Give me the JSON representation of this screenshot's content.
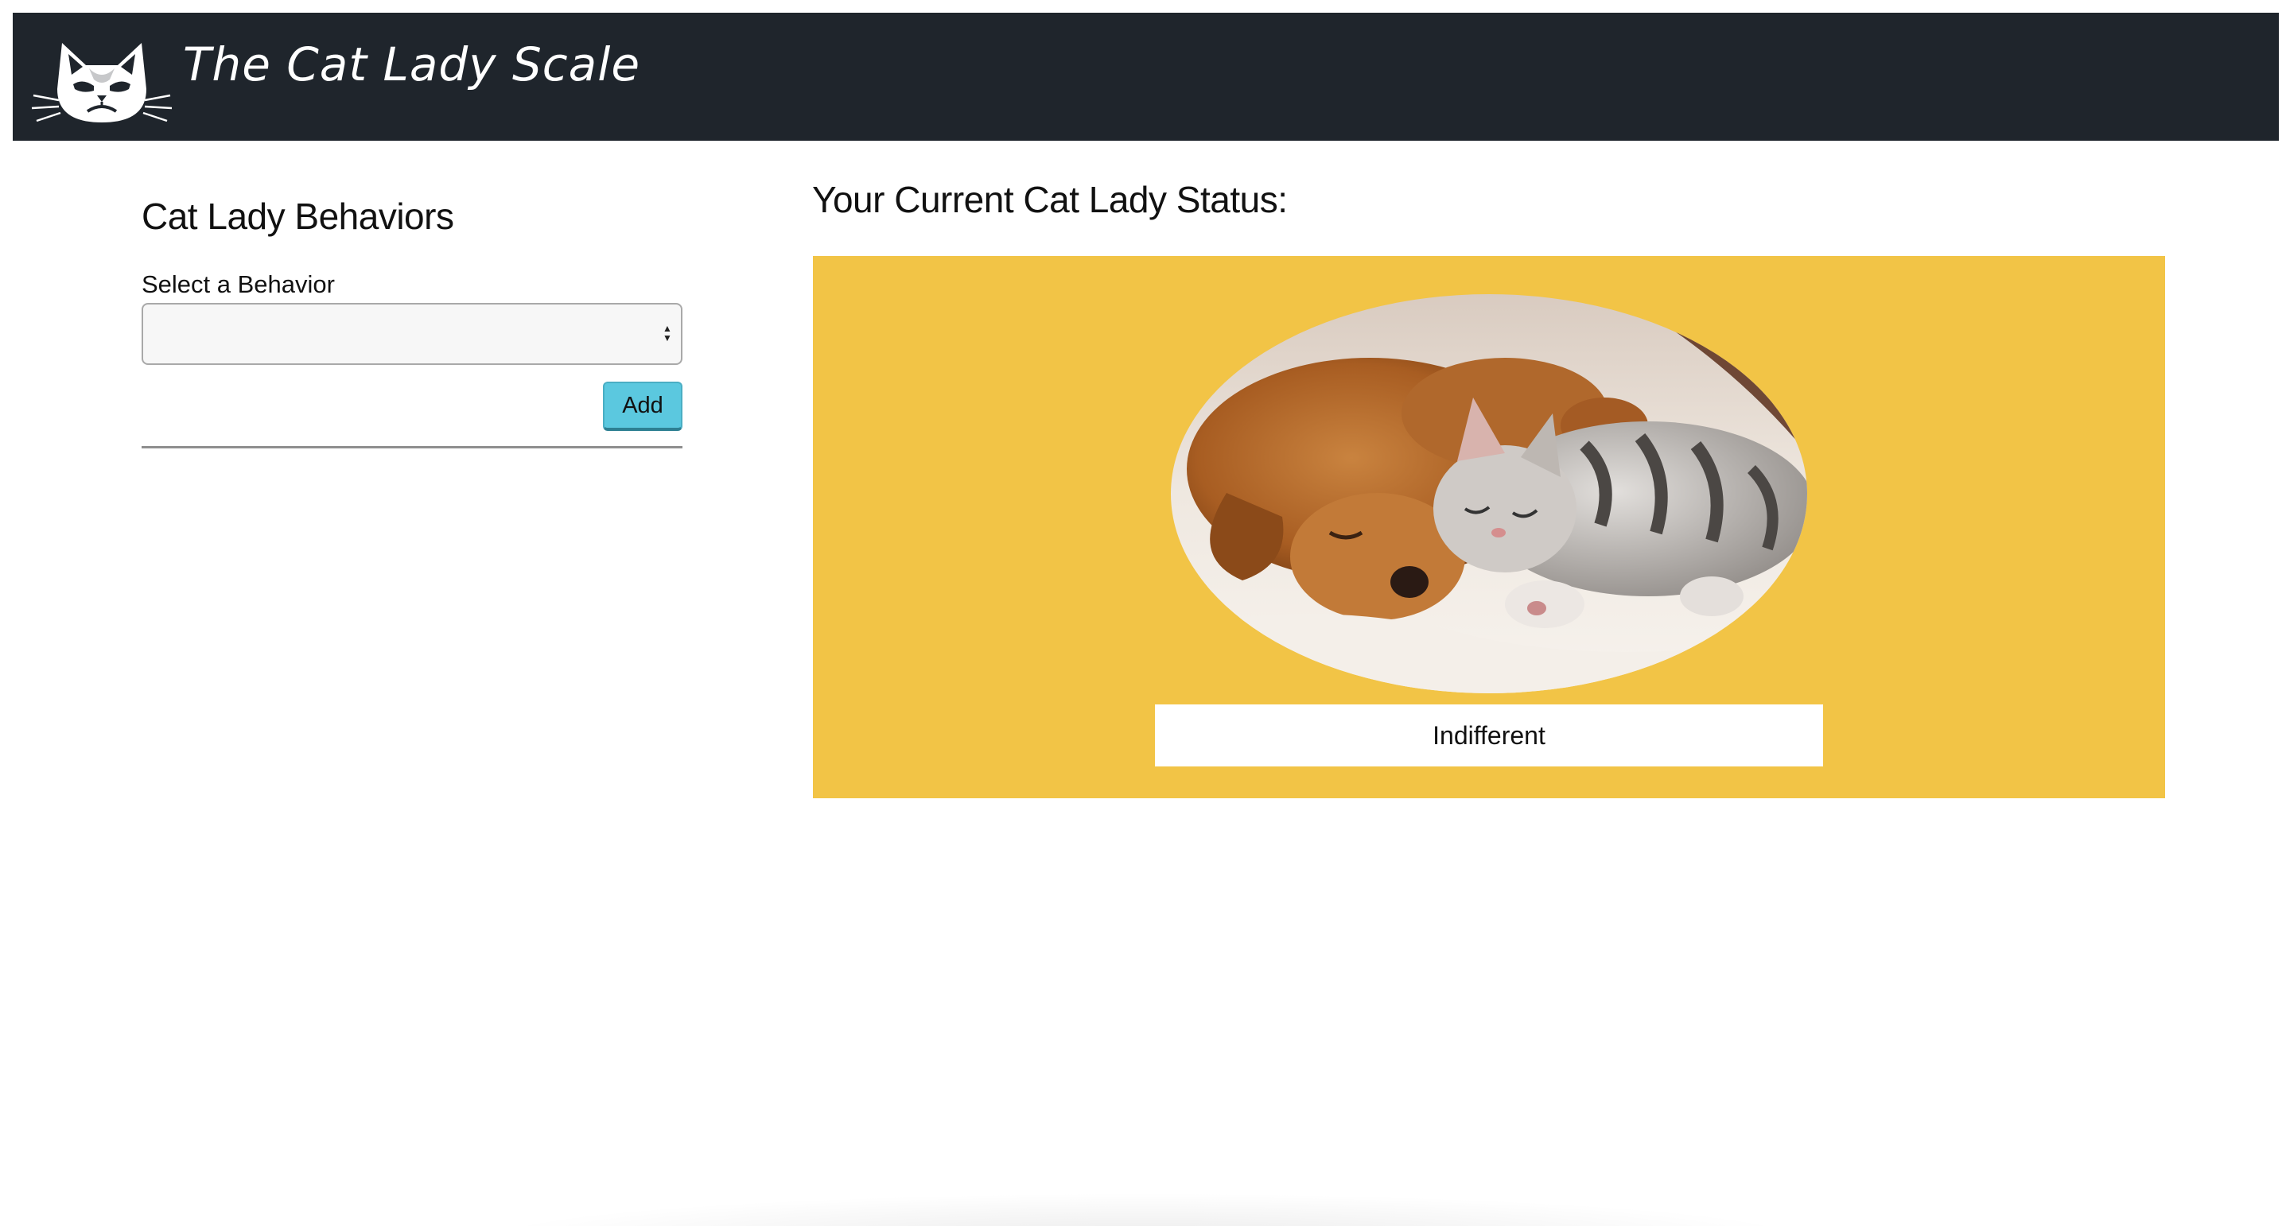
{
  "header": {
    "brand_title": "The Cat Lady Scale",
    "logo_icon": "grumpy-cat-icon",
    "background_color": "#1f252c"
  },
  "behaviors": {
    "title": "Cat Lady Behaviors",
    "select_label": "Select a Behavior",
    "select_value": "",
    "add_label": "Add",
    "add_color": "#5bc8df"
  },
  "status": {
    "title": "Your Current Cat Lady Status:",
    "image_alt": "puppy-and-kitten-photo",
    "level": "Indifferent",
    "panel_color": "#f2c446"
  }
}
